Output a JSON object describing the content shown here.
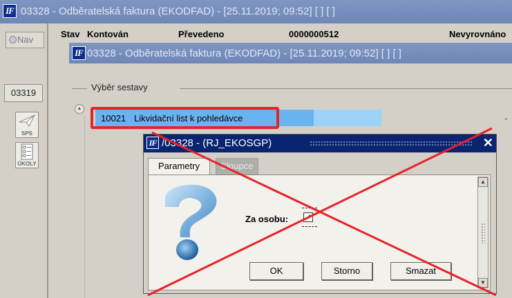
{
  "window": {
    "title": "03328 - Odběratelská faktura (EKODFAD) - [25.11.2019; 09:52]  [ ]  [ ]",
    "logo": "IF"
  },
  "sidebar": {
    "nav_label": "Nav",
    "code": "03319",
    "tools": [
      {
        "label": "SPS",
        "icon": "paper-plane-icon"
      },
      {
        "label": "ÚKOLY",
        "icon": "task-list-icon"
      }
    ]
  },
  "header": {
    "stav": "Stav",
    "kontovan": "Kontován",
    "prevedeno": "Převedeno",
    "number": "0000000512",
    "status": "Nevyrovnáno"
  },
  "form": {
    "title": "03328 - Odběratelská faktura (EKODFAD) - [25.11.2019; 09:52]  [ ]  [ ]",
    "group_label": "Výběr sestavy",
    "list": [
      {
        "code": "10021",
        "name": "Likvidační list k pohledávce"
      }
    ],
    "dash": "-"
  },
  "dialog": {
    "title": "/03328 - (RJ_EKOSGP)",
    "close": "✕",
    "tabs": [
      {
        "label": "Parametry",
        "active": true
      },
      {
        "label": "Sloupce",
        "active": false
      }
    ],
    "field_label": "Za osobu:",
    "checkbox_checked": true,
    "buttons": {
      "ok": "OK",
      "storno": "Storno",
      "smazat": "Smazat"
    }
  },
  "colors": {
    "title_inactive": "#7489b8",
    "title_active": "#0a2470",
    "selection": "#69b4ef",
    "annotation_red": "#e8212a"
  }
}
